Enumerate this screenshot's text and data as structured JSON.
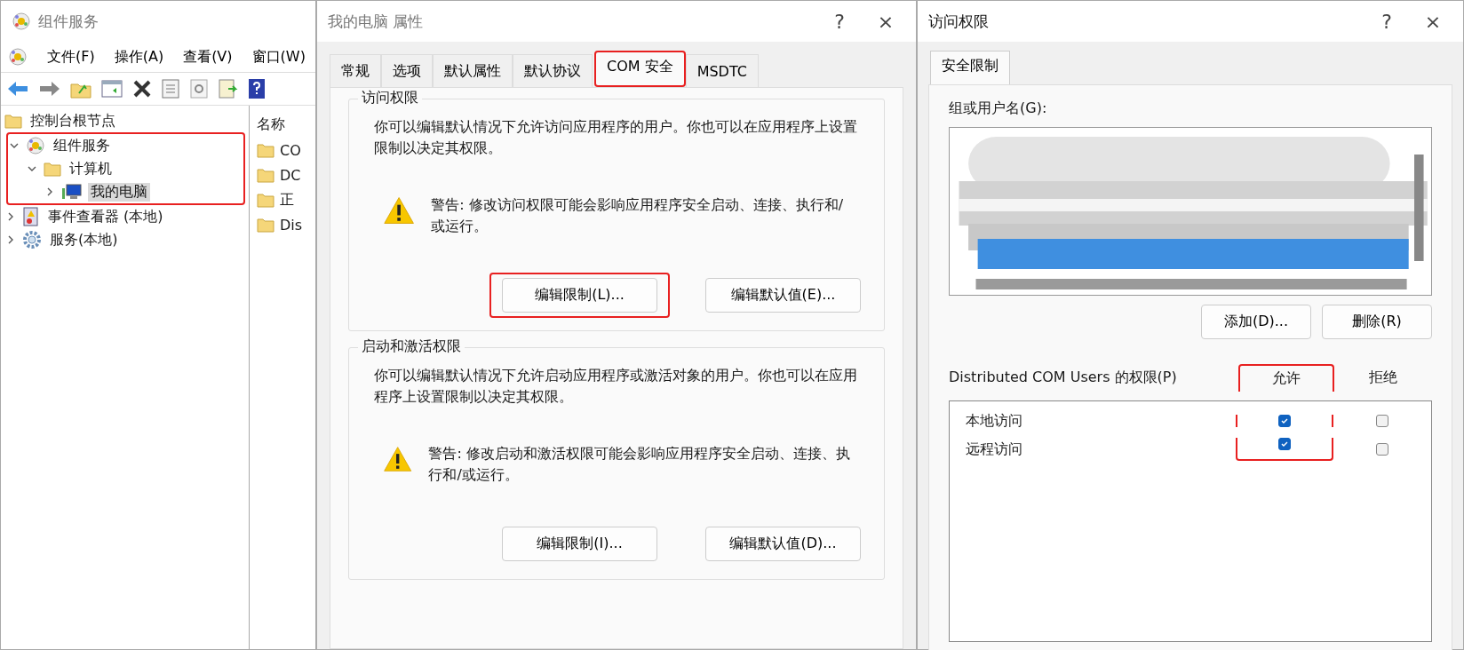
{
  "main_window": {
    "title": "组件服务",
    "menu": [
      "文件(F)",
      "操作(A)",
      "查看(V)",
      "窗口(W)"
    ],
    "tree": [
      {
        "label": "控制台根节点",
        "kind": "folder",
        "selected": false,
        "annotated": false,
        "children": [
          {
            "label": "组件服务",
            "kind": "component",
            "selected": false,
            "expanded": true,
            "annotated": true,
            "children": [
              {
                "label": "计算机",
                "kind": "folder",
                "selected": false,
                "expanded": true,
                "children": [
                  {
                    "label": "我的电脑",
                    "kind": "computer",
                    "selected": true,
                    "expanded": false
                  }
                ]
              }
            ]
          },
          {
            "label": "事件查看器 (本地)",
            "kind": "log",
            "selected": false,
            "expanded": false,
            "annotated": false
          },
          {
            "label": "服务(本地)",
            "kind": "gear",
            "selected": false,
            "expanded": false,
            "annotated": false
          }
        ]
      }
    ],
    "list_header": "名称",
    "list_items": [
      "CO",
      "DC",
      "正",
      "Dis"
    ]
  },
  "properties_dialog": {
    "title": "我的电脑 属性",
    "help": "?",
    "close": "×",
    "tabs": [
      {
        "label": "常规",
        "selected": false,
        "annotated": false
      },
      {
        "label": "选项",
        "selected": false,
        "annotated": false
      },
      {
        "label": "默认属性",
        "selected": false,
        "annotated": false
      },
      {
        "label": "默认协议",
        "selected": false,
        "annotated": false
      },
      {
        "label": "COM 安全",
        "selected": true,
        "annotated": true
      },
      {
        "label": "MSDTC",
        "selected": false,
        "annotated": false
      }
    ],
    "groups": [
      {
        "title": "访问权限",
        "description": "你可以编辑默认情况下允许访问应用程序的用户。你也可以在应用程序上设置限制以决定其权限。",
        "warning": "警告: 修改访问权限可能会影响应用程序安全启动、连接、执行和/或运行。",
        "buttons": [
          {
            "label": "编辑限制(L)...",
            "annotated": true
          },
          {
            "label": "编辑默认值(E)...",
            "annotated": false
          }
        ]
      },
      {
        "title": "启动和激活权限",
        "description": "你可以编辑默认情况下允许启动应用程序或激活对象的用户。你也可以在应用程序上设置限制以决定其权限。",
        "warning": "警告: 修改启动和激活权限可能会影响应用程序安全启动、连接、执行和/或运行。",
        "buttons": [
          {
            "label": "编辑限制(I)...",
            "annotated": false
          },
          {
            "label": "编辑默认值(D)...",
            "annotated": false
          }
        ]
      }
    ]
  },
  "access_dialog": {
    "title": "访问权限",
    "help": "?",
    "close": "×",
    "tabs": [
      {
        "label": "安全限制",
        "selected": true
      }
    ],
    "users_label": "组或用户名(G):",
    "buttons": [
      "添加(D)...",
      "删除(R)"
    ],
    "permissions_label": "Distributed COM Users 的权限(P)",
    "columns": [
      {
        "label": "允许",
        "annotated": true
      },
      {
        "label": "拒绝",
        "annotated": false
      }
    ],
    "permissions": [
      {
        "name": "本地访问",
        "allow": true,
        "deny": false
      },
      {
        "name": "远程访问",
        "allow": true,
        "deny": false
      }
    ]
  }
}
